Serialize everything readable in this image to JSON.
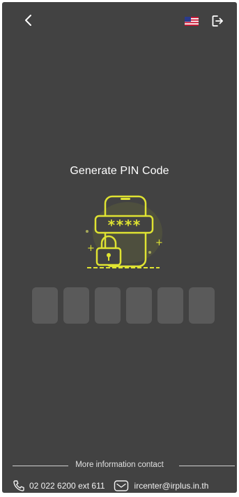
{
  "header": {
    "back_icon": "chevron-left-icon",
    "language_flag": "us-flag-icon",
    "logout_icon": "logout-icon"
  },
  "main": {
    "title": "Generate PIN Code",
    "illustration_icon": "phone-lock-pin-illustration",
    "pin_masked_text": "****",
    "pin_length": 6
  },
  "footer": {
    "contact_heading": "More information contact",
    "phone": "02 022 6200 ext 611",
    "phone_icon": "phone-icon",
    "email": "ircenter@irplus.in.th",
    "email_icon": "email-icon"
  },
  "colors": {
    "background": "#424242",
    "accent": "#dfe332",
    "pin_box": "#5a5a5a",
    "text": "#ffffff"
  }
}
